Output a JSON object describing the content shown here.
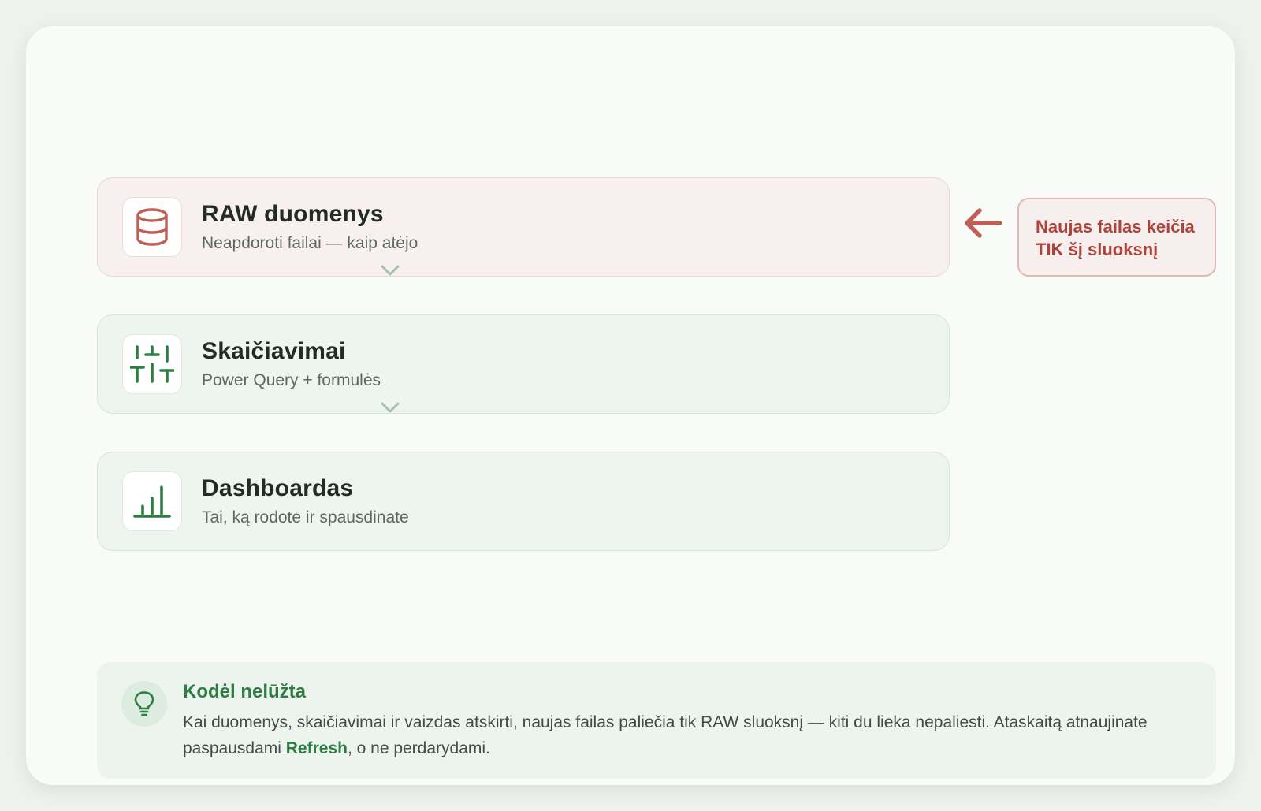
{
  "colors": {
    "raw_accent": "#bd5f55",
    "green_accent": "#2e7d44",
    "callout_text": "#ad443b",
    "chevron": "#a9bfae"
  },
  "layers": [
    {
      "title": "RAW duomenys",
      "subtitle": "Neapdoroti failai — kaip atėjo",
      "icon": "database-icon"
    },
    {
      "title": "Skaičiavimai",
      "subtitle": "Power Query + formulės",
      "icon": "sliders-icon"
    },
    {
      "title": "Dashboardas",
      "subtitle": "Tai, ką rodote ir spausdinate",
      "icon": "bar-chart-icon"
    }
  ],
  "callout": {
    "line1": "Naujas failas keičia",
    "line2": "TIK šį sluoksnį",
    "icon": "arrow-left-icon"
  },
  "tip": {
    "icon": "lightbulb-icon",
    "title": "Kodėl nelūžta",
    "body_before": "Kai duomenys, skaičiavimai ir vaizdas atskirti, naujas failas paliečia tik RAW sluoksnį — kiti du lieka nepaliesti. Ataskaitą atnaujinate paspausdami ",
    "body_highlight": "Refresh",
    "body_after": ", o ne perdarydami."
  }
}
